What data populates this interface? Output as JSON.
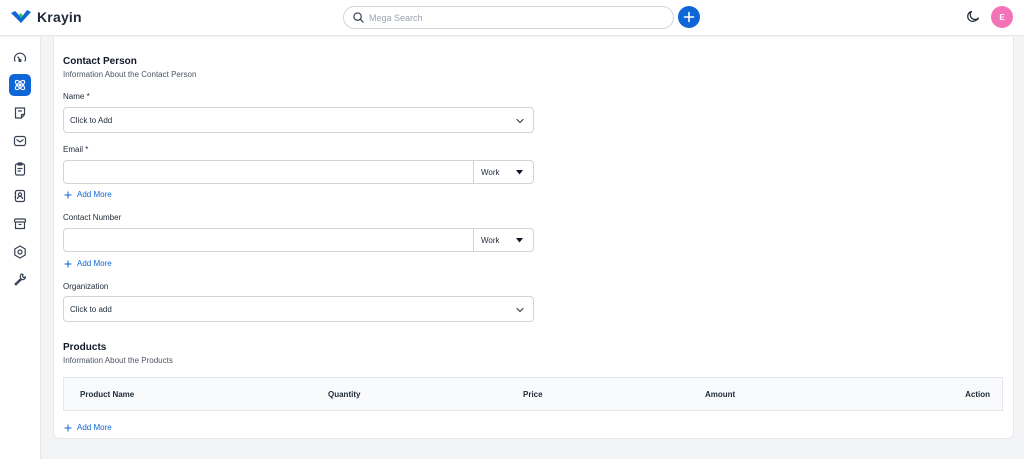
{
  "header": {
    "brand": "Krayin",
    "search_placeholder": "Mega Search",
    "avatar_initial": "E",
    "colors": {
      "accent": "#0e66d7",
      "avatar": "#f472b6"
    }
  },
  "sidebar": {
    "items": [
      {
        "name": "dashboard",
        "icon": "gauge-icon",
        "active": false
      },
      {
        "name": "leads",
        "icon": "atom-icon",
        "active": true
      },
      {
        "name": "quotes",
        "icon": "note-icon",
        "active": false
      },
      {
        "name": "mail",
        "icon": "mail-icon",
        "active": false
      },
      {
        "name": "activities",
        "icon": "clipboard-icon",
        "active": false
      },
      {
        "name": "contacts",
        "icon": "contact-book-icon",
        "active": false
      },
      {
        "name": "products",
        "icon": "box-icon",
        "active": false
      },
      {
        "name": "settings",
        "icon": "gear-icon",
        "active": false
      },
      {
        "name": "configuration",
        "icon": "wrench-icon",
        "active": false
      }
    ]
  },
  "contact_person": {
    "title": "Contact Person",
    "subtitle": "Information About the Contact Person",
    "name_label": "Name *",
    "name_placeholder": "Click to Add",
    "email_label": "Email *",
    "email_value": "",
    "email_type": "Work",
    "email_add_more": "Add More",
    "phone_label": "Contact Number",
    "phone_value": "",
    "phone_type": "Work",
    "phone_add_more": "Add More",
    "organization_label": "Organization",
    "organization_placeholder": "Click to add"
  },
  "products": {
    "title": "Products",
    "subtitle": "Information About the Products",
    "columns": [
      "Product Name",
      "Quantity",
      "Price",
      "Amount",
      "Action"
    ],
    "add_more": "Add More"
  }
}
